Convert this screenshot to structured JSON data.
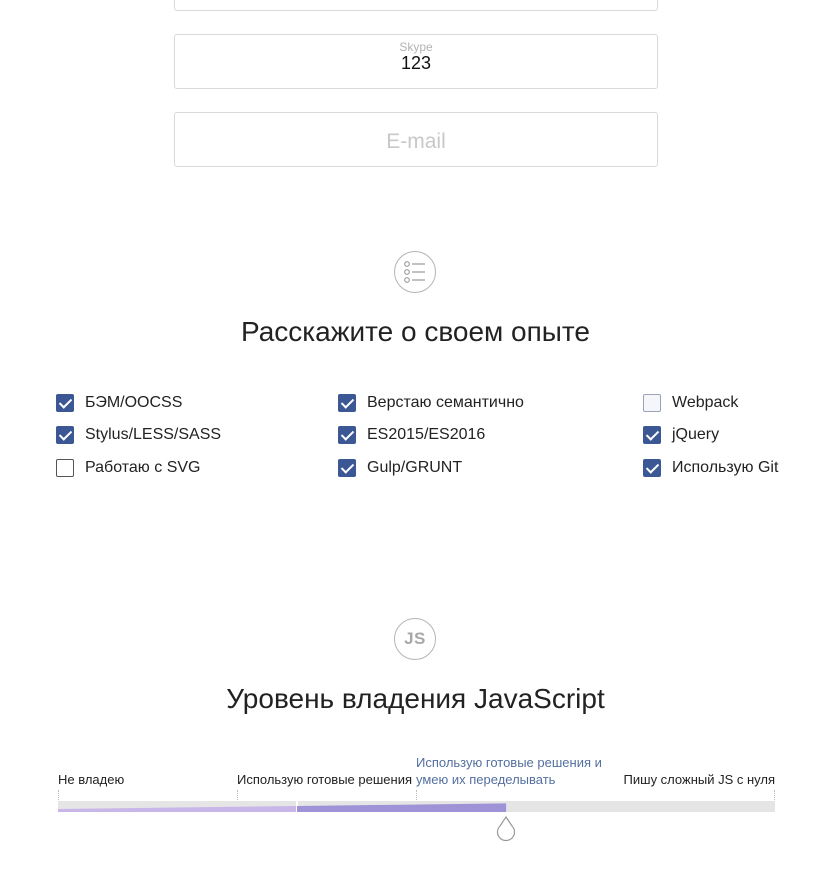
{
  "form": {
    "skype": {
      "label": "Skype",
      "value": "123"
    },
    "email": {
      "placeholder": "E-mail"
    }
  },
  "experience": {
    "icon": "list-icon",
    "title": "Расскажите о своем опыте",
    "options": [
      {
        "label": "БЭМ/OOCSS",
        "checked": true
      },
      {
        "label": "Stylus/LESS/SASS",
        "checked": true
      },
      {
        "label": "Работаю с SVG",
        "checked": false
      },
      {
        "label": "Верстаю семантично",
        "checked": true
      },
      {
        "label": "ES2015/ES2016",
        "checked": true
      },
      {
        "label": "Gulp/GRUNT",
        "checked": true
      },
      {
        "label": "Webpack",
        "checked": false
      },
      {
        "label": "jQuery",
        "checked": true
      },
      {
        "label": "Использую Git",
        "checked": true
      }
    ]
  },
  "js_level": {
    "icon_text": "JS",
    "title": "Уровень владения JavaScript",
    "levels": [
      "Не владею",
      "Использую готовые решения",
      "Использую готовые решения и умею их переделывать",
      "Пишу сложный JS с нуля"
    ],
    "selected_index": 2,
    "progress_fraction": 0.625,
    "colors": {
      "fill_light": "#c8b6e8",
      "fill_mid": "#9f92d6",
      "fill_dark": "#7c7cc6",
      "track": "#e5e5e5",
      "checkbox": "#3b5794"
    }
  }
}
